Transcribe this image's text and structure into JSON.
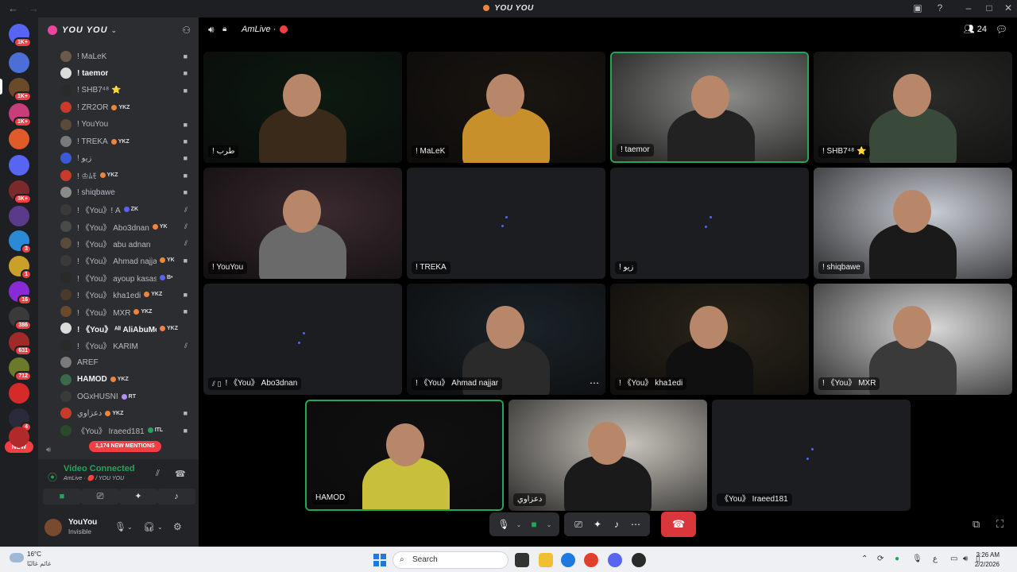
{
  "titlebar": {
    "title": "YOU YOU",
    "back": "←",
    "forward": "→"
  },
  "rail": {
    "servers": [
      {
        "name": "discord-home",
        "color": "#5865f2",
        "badge": "1K+"
      },
      {
        "name": "server-2",
        "color": "#4b6fd6",
        "badge": ""
      },
      {
        "name": "server-3",
        "color": "#6b4a2a",
        "badge": "1K+"
      },
      {
        "name": "server-4",
        "color": "#c83e7a",
        "badge": "1K+"
      },
      {
        "name": "server-5",
        "color": "#e05a2a",
        "badge": ""
      },
      {
        "name": "server-6",
        "color": "#5865f2",
        "badge": ""
      },
      {
        "name": "server-7",
        "color": "#7a2a2a",
        "badge": "3K+"
      },
      {
        "name": "server-8",
        "color": "#5a3a8a",
        "badge": ""
      },
      {
        "name": "server-9",
        "color": "#2a8ad6",
        "badge": "3"
      },
      {
        "name": "server-10",
        "color": "#c8a02a",
        "badge": "1"
      },
      {
        "name": "server-11",
        "color": "#8a2ad6",
        "badge": "16"
      },
      {
        "name": "server-12",
        "color": "#3a3a3a",
        "badge": "386"
      },
      {
        "name": "server-13",
        "color": "#a02a2a",
        "badge": "631"
      },
      {
        "name": "server-14",
        "color": "#6a7a2a",
        "badge": "712"
      },
      {
        "name": "server-15",
        "color": "#d62a2a",
        "badge": ""
      },
      {
        "name": "server-16",
        "color": "#2a2a3a",
        "badge": "4"
      },
      {
        "name": "server-17",
        "color": "#b02a2a",
        "badge": ""
      }
    ],
    "new_label": "NEW"
  },
  "guild": {
    "name": "YOU YOU"
  },
  "members": [
    {
      "name": "! MaLeK",
      "bold": false,
      "color": "#6a5a4a",
      "tag": "",
      "tag_color": "",
      "status": "cam"
    },
    {
      "name": "! taemor",
      "bold": true,
      "color": "#dcdcdc",
      "tag": "",
      "tag_color": "",
      "status": "cam"
    },
    {
      "name": "! SHB7⁴⁸ ⭐",
      "bold": false,
      "color": "#2a2a2a",
      "tag": "",
      "tag_color": "",
      "status": "cam"
    },
    {
      "name": "! ZR2OR",
      "bold": false,
      "color": "#c83a2a",
      "tag": "YKZ",
      "tag_color": "#f0843a",
      "status": ""
    },
    {
      "name": "! YouYou",
      "bold": false,
      "color": "#5a4a3a",
      "tag": "",
      "tag_color": "",
      "status": "cam"
    },
    {
      "name": "! TREKA",
      "bold": false,
      "color": "#7a7a7a",
      "tag": "YKZ",
      "tag_color": "#f0843a",
      "status": "cam"
    },
    {
      "name": "! زيو",
      "bold": false,
      "color": "#3a5ad6",
      "tag": "",
      "tag_color": "",
      "status": "cam"
    },
    {
      "name": "! ♔ﾑﾓ",
      "bold": false,
      "color": "#c83a2a",
      "tag": "YKZ",
      "tag_color": "#f0843a",
      "status": "cam"
    },
    {
      "name": "! shiqbawe",
      "bold": false,
      "color": "#8a8a8a",
      "tag": "",
      "tag_color": "",
      "status": "cam"
    },
    {
      "name": "! 《You》! A",
      "bold": false,
      "color": "#3a3a3a",
      "tag": "ZK",
      "tag_color": "#5865f2",
      "status": "deaf"
    },
    {
      "name": "! 《You》 Abo3dnan",
      "bold": false,
      "color": "#4a4a4a",
      "tag": "YK",
      "tag_color": "#f0843a",
      "status": "deaf"
    },
    {
      "name": "! 《You》 abu adnan",
      "bold": false,
      "color": "#5a4a3a",
      "tag": "",
      "tag_color": "",
      "status": "deaf"
    },
    {
      "name": "! 《You》 Ahmad najjar",
      "bold": false,
      "color": "#3a3a3a",
      "tag": "YK",
      "tag_color": "#f0843a",
      "status": "cam"
    },
    {
      "name": "! 《You》 ayoup kasasbeh",
      "bold": false,
      "color": "#2a2a2a",
      "tag": "B•",
      "tag_color": "#5865f2",
      "status": ""
    },
    {
      "name": "! 《You》 kha1edi",
      "bold": false,
      "color": "#4a3a2a",
      "tag": "YKZ",
      "tag_color": "#f0843a",
      "status": "cam"
    },
    {
      "name": "! 《You》 MXR",
      "bold": false,
      "color": "#6a4a2a",
      "tag": "YKZ",
      "tag_color": "#f0843a",
      "status": "cam"
    },
    {
      "name": "! 《You》 ᴬˡᴵ AliAbuMousa",
      "bold": true,
      "color": "#dcdcdc",
      "tag": "YKZ",
      "tag_color": "#f0843a",
      "status": ""
    },
    {
      "name": "! 《You》 KARIM",
      "bold": false,
      "color": "#2a2a2a",
      "tag": "",
      "tag_color": "",
      "status": "deaf"
    },
    {
      "name": "AREF",
      "bold": false,
      "color": "#7a7a7a",
      "tag": "",
      "tag_color": "",
      "status": ""
    },
    {
      "name": "HAMOD",
      "bold": true,
      "color": "#3a6a4a",
      "tag": "YKZ",
      "tag_color": "#f0843a",
      "status": ""
    },
    {
      "name": "OGxHUSNI",
      "bold": false,
      "color": "#3a3a3a",
      "tag": "RT",
      "tag_color": "#b38cff",
      "status": ""
    },
    {
      "name": "دعزاوي",
      "bold": false,
      "color": "#c83a2a",
      "tag": "YKZ",
      "tag_color": "#f0843a",
      "status": "cam"
    },
    {
      "name": "《You》 Iraeed181",
      "bold": false,
      "color": "#2a4a2a",
      "tag": "ITL",
      "tag_color": "#23a55a",
      "status": "cam"
    }
  ],
  "mentions_label": "1,174 NEW MENTIONS",
  "voice": {
    "status": "Video Connected",
    "channel": "AmLive · 🔴 / YOU YOU",
    "buttons": [
      "camera",
      "screen-share",
      "activities",
      "soundboard"
    ]
  },
  "user": {
    "name": "YouYou",
    "status": "Invisible"
  },
  "call": {
    "channel_name": "AmLive ·",
    "participant_count": "24",
    "tiles": [
      {
        "label": "! طرب",
        "type": "video",
        "speaking": false,
        "bg": "#0c1a10",
        "person": "#3a2a1a",
        "more": false,
        "icon": ""
      },
      {
        "label": "! MaLeK",
        "type": "video",
        "speaking": false,
        "bg": "#1a1510",
        "person": "#c8902a",
        "more": false,
        "icon": ""
      },
      {
        "label": "! taemor",
        "type": "video",
        "speaking": true,
        "bg": "#8a8a88",
        "person": "#222",
        "more": false,
        "icon": ""
      },
      {
        "label": "! SHB7⁴⁸ ⭐",
        "type": "video",
        "speaking": false,
        "bg": "#2a2a28",
        "person": "#3a4a3a",
        "more": false,
        "icon": ""
      },
      {
        "label": "! YouYou",
        "type": "video",
        "speaking": false,
        "bg": "#3a2a30",
        "person": "#6a6a6a",
        "more": false,
        "icon": ""
      },
      {
        "label": "! TREKA",
        "type": "empty",
        "speaking": false,
        "bg": "",
        "person": "",
        "more": false,
        "icon": ""
      },
      {
        "label": "! زيو",
        "type": "empty",
        "speaking": false,
        "bg": "",
        "person": "",
        "more": false,
        "icon": ""
      },
      {
        "label": "! shiqbawe",
        "type": "video",
        "speaking": false,
        "bg": "#c8ccd4",
        "person": "#1a1a1a",
        "more": false,
        "icon": ""
      },
      {
        "label": "! 《You》 Abo3dnan",
        "type": "empty",
        "speaking": false,
        "bg": "",
        "person": "",
        "more": false,
        "icon": "deaf"
      },
      {
        "label": "! 《You》 Ahmad najjar",
        "type": "video",
        "speaking": false,
        "bg": "#1a2228",
        "person": "#2a2a2a",
        "more": true,
        "icon": ""
      },
      {
        "label": "! 《You》 kha1edi",
        "type": "video",
        "speaking": false,
        "bg": "#2a241a",
        "person": "#101010",
        "more": false,
        "icon": ""
      },
      {
        "label": "! 《You》 MXR",
        "type": "video",
        "speaking": false,
        "bg": "#d8d8d8",
        "person": "#3a3a3a",
        "more": false,
        "icon": ""
      },
      {
        "label": "HAMOD",
        "type": "video",
        "speaking": true,
        "bg": "#101010",
        "person": "#c8c03a",
        "more": false,
        "icon": ""
      },
      {
        "label": "دعزاوي",
        "type": "video",
        "speaking": false,
        "bg": "#c8c4bc",
        "person": "#1a1a1a",
        "more": false,
        "icon": ""
      },
      {
        "label": "《You》 Iraeed181",
        "type": "empty",
        "speaking": false,
        "bg": "",
        "person": "",
        "more": false,
        "icon": ""
      }
    ]
  },
  "taskbar": {
    "temperature": "16°C",
    "condition": "غائم غالبًا",
    "search_placeholder": "Search",
    "time": "3:26 AM",
    "date": "2/2/2026",
    "language": "ع"
  }
}
